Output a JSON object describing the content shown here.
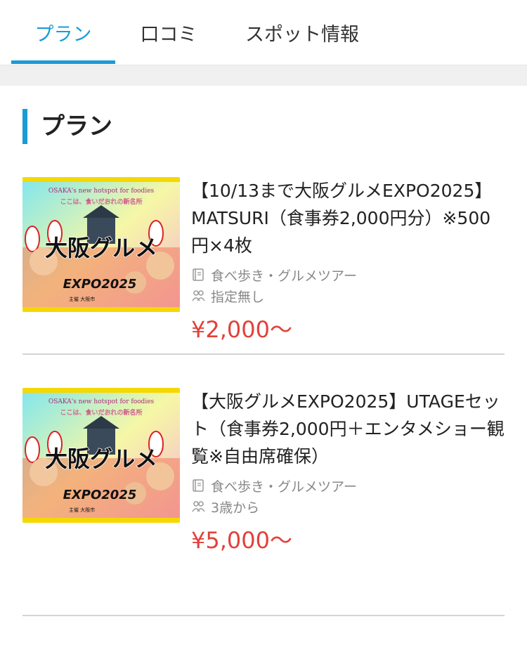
{
  "tabs": [
    {
      "label": "プラン",
      "active": true
    },
    {
      "label": "口コミ",
      "active": false
    },
    {
      "label": "スポット情報",
      "active": false
    }
  ],
  "section": {
    "title": "プラン"
  },
  "plans": [
    {
      "name": "【10/13まで大阪グルメEXPO2025】MATSURI（食事券2,000円分）※500円×4枚",
      "category": "食べ歩き・グルメツアー",
      "age": "指定無し",
      "price": "¥2,000〜",
      "image": {
        "tagline": "OSAKA's new hotspot for foodies",
        "subtitle": "ここは、食いだおれの新名所",
        "title": "大阪グルメ",
        "expo": "EXPO2025",
        "host": "主催 大阪市"
      }
    },
    {
      "name": "【大阪グルメEXPO2025】UTAGEセット（食事券2,000円＋エンタメショー観覧※自由席確保）",
      "category": "食べ歩き・グルメツアー",
      "age": "3歳から",
      "price": "¥5,000〜",
      "image": {
        "tagline": "OSAKA's new hotspot for foodies",
        "subtitle": "ここは、食いだおれの新名所",
        "title": "大阪グルメ",
        "expo": "EXPO2025",
        "host": "主催 大阪市"
      }
    }
  ],
  "colors": {
    "accent": "#1a9bd7",
    "price": "#e2413a"
  }
}
